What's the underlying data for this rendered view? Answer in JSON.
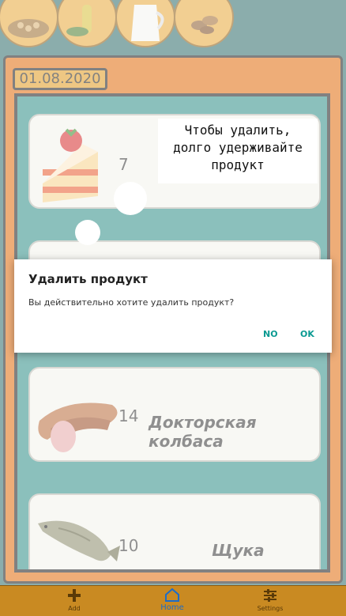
{
  "categories": [
    {
      "name": "grain-category-icon"
    },
    {
      "name": "oil-category-icon"
    },
    {
      "name": "milk-category-icon"
    },
    {
      "name": "nuts-category-icon"
    }
  ],
  "date": "01.08.2020",
  "tooltip": {
    "line1": "Чтобы удалить,",
    "line2": "долго удерживайте",
    "line3": "продукт"
  },
  "products": [
    {
      "count": "7",
      "name": "",
      "icon": "cake-icon"
    },
    {
      "count": "",
      "name": "",
      "icon": "hidden-product-icon"
    },
    {
      "count": "14",
      "name": "Докторская колбаса",
      "icon": "sausage-icon"
    },
    {
      "count": "10",
      "name": "Щука",
      "icon": "pike-fish-icon"
    }
  ],
  "dialog": {
    "title": "Удалить продукт",
    "message": "Вы действительно хотите удалить продукт?",
    "no_label": "NO",
    "ok_label": "OK"
  },
  "nav": {
    "add_label": "Add",
    "home_label": "Home",
    "settings_label": "Settings"
  },
  "colors": {
    "accent": "#0a9a92",
    "frame": "#e06a0a",
    "list_bg": "#2c8c86",
    "nav_bg": "#c98a22",
    "nav_active": "#1d6cc7"
  }
}
